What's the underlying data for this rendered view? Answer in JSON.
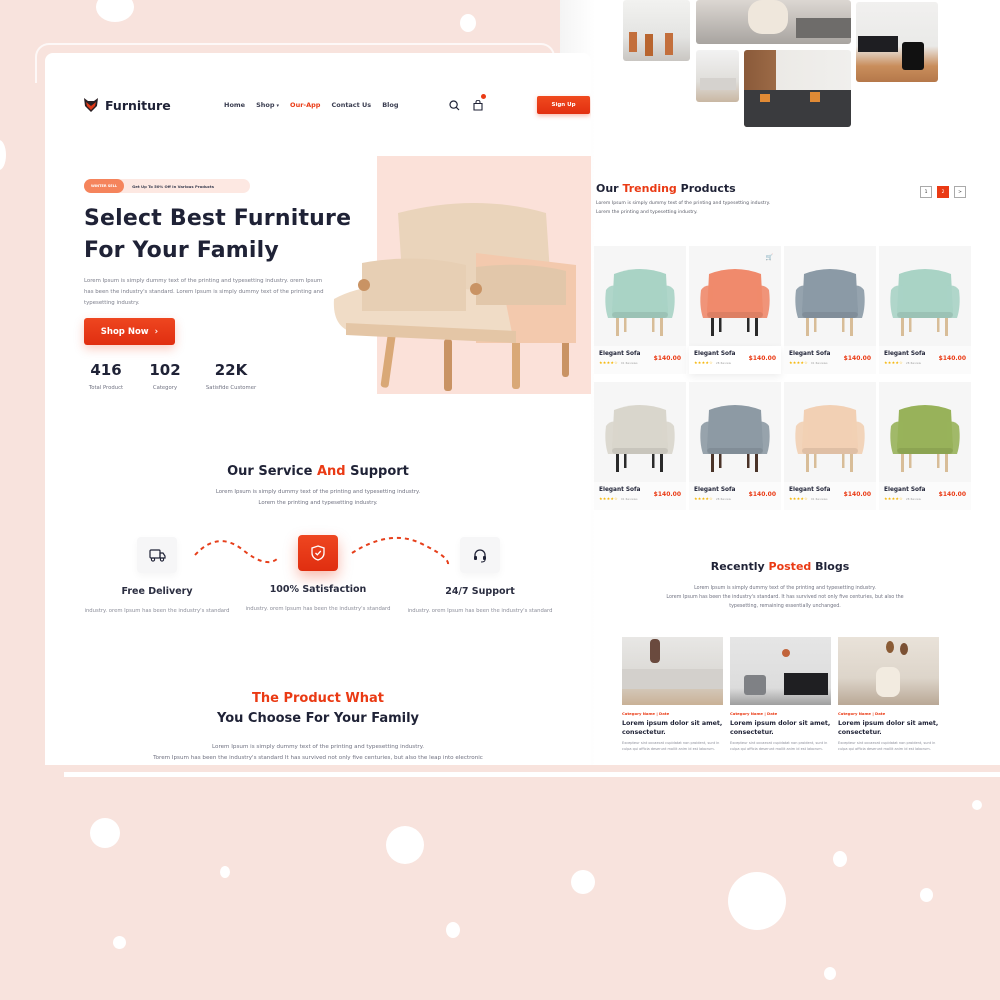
{
  "brand": {
    "name": "Furniture",
    "accent": "#ea3a14",
    "background": "#f8e3dd"
  },
  "nav": {
    "links": [
      {
        "label": "Home"
      },
      {
        "label": "Shop"
      },
      {
        "label": "Our-App"
      },
      {
        "label": "Contact Us"
      },
      {
        "label": "Blog"
      }
    ],
    "active": "Our-App",
    "signup_label": "Sign Up"
  },
  "hero": {
    "promo_tag": "WINTER SELL",
    "promo_text": "Get Up To 50% Off In Various Products",
    "title_line1": "Select Best Furniture",
    "title_line2": "For Your Family",
    "description": "Lorem Ipsum is simply dummy text of the printing and typesetting industry. orem Ipsum has been the industry's standard. Lorem Ipsum is simply dummy text of the printing and typesetting industry.",
    "cta_label": "Shop Now",
    "stats": [
      {
        "value": "416",
        "label": "Total Product"
      },
      {
        "value": "102",
        "label": "Category"
      },
      {
        "value": "22K",
        "label": "Satisfide Customer"
      }
    ]
  },
  "service": {
    "title_part1": "Our Service ",
    "title_accent": "And",
    "title_part2": " Support",
    "desc_line1": "Lorem Ipsum is simply dummy text of the printing and typesetting industry.",
    "desc_line2": "Lorem the printing and typesetting industry.",
    "items": [
      {
        "icon": "truck-icon",
        "title": "Free Delivery",
        "desc": "industry. orem Ipsum has been the industry's standard"
      },
      {
        "icon": "shield-check-icon",
        "title": "100% Satisfaction",
        "desc": "industry. orem Ipsum has been the industry's standard"
      },
      {
        "icon": "headset-icon",
        "title": "24/7 Support",
        "desc": "industry. orem Ipsum has been the industry's standard"
      }
    ]
  },
  "product_what": {
    "title_line1": "The Product What",
    "title_line2": "You Choose For Your Family",
    "desc_line1": "Lorem Ipsum is simply dummy text of the printing and typesetting industry.",
    "desc_line2": "Torem Ipsum has been the industry's standard  It has survived not only five centuries, but also the leap into electronic"
  },
  "trending": {
    "title_part1": "Our ",
    "title_accent": "Trending",
    "title_part2": " Products",
    "desc_line1": "Lorem Ipsum is simply dummy text of the printing and typesetting industry.",
    "desc_line2": "Lorem the printing and typesetting industry.",
    "pages": [
      "1",
      "2",
      ">"
    ],
    "current_page": "2",
    "products": [
      {
        "name": "Elegant Sofa",
        "price": "$140.00",
        "rating": 4,
        "reviews": "01 Reviews",
        "color": "#a9d3c5"
      },
      {
        "name": "Elegant Sofa",
        "price": "$140.00",
        "rating": 4,
        "reviews": "28 Review",
        "color": "#f08a6c"
      },
      {
        "name": "Elegant Sofa",
        "price": "$140.00",
        "rating": 4,
        "reviews": "01 Reviews",
        "color": "#8b9aa6"
      },
      {
        "name": "Elegant Sofa",
        "price": "$140.00",
        "rating": 4,
        "reviews": "28 Review",
        "color": "#a9d3c5"
      },
      {
        "name": "Elegant Sofa",
        "price": "$140.00",
        "rating": 4,
        "reviews": "01 Reviews",
        "color": "#d9d6cc"
      },
      {
        "name": "Elegant Sofa",
        "price": "$140.00",
        "rating": 4,
        "reviews": "28 Review",
        "color": "#8d9aa4"
      },
      {
        "name": "Elegant Sofa",
        "price": "$140.00",
        "rating": 4,
        "reviews": "01 Reviews",
        "color": "#f2d0b4"
      },
      {
        "name": "Elegant Sofa",
        "price": "$140.00",
        "rating": 4,
        "reviews": "28 Review",
        "color": "#98b25a"
      }
    ]
  },
  "blogs": {
    "title_part1": "Recently ",
    "title_accent": "Posted",
    "title_part2": " Blogs",
    "desc_line1": "Lorem Ipsum is simply dummy text of the printing and typesetting industry.",
    "desc_line2": "Lorem Ipsum has been the industry's standard. It has survived not only five centuries, but also the",
    "desc_line3": "typesetting, remaining essentially unchanged.",
    "posts": [
      {
        "category": "Category Name  |  Date",
        "title": "Lorem ipsum dolor sit amet, consectetur.",
        "excerpt": "Excepteur sint occaecat cupidatat non proident, sunt in culpa qui officia deserunt mollit anim id est laborum."
      },
      {
        "category": "Category Name  |  Date",
        "title": "Lorem ipsum dolor sit amet, consectetur.",
        "excerpt": "Excepteur sint occaecat cupidatat non proident, sunt in culpa qui officia deserunt mollit anim id est laborum."
      },
      {
        "category": "Category Name  |  Date",
        "title": "Lorem ipsum dolor sit amet, consectetur.",
        "excerpt": "Excepteur sint occaecat cupidatat non proident, sunt in culpa qui officia deserunt mollit anim id est laborum."
      }
    ]
  }
}
